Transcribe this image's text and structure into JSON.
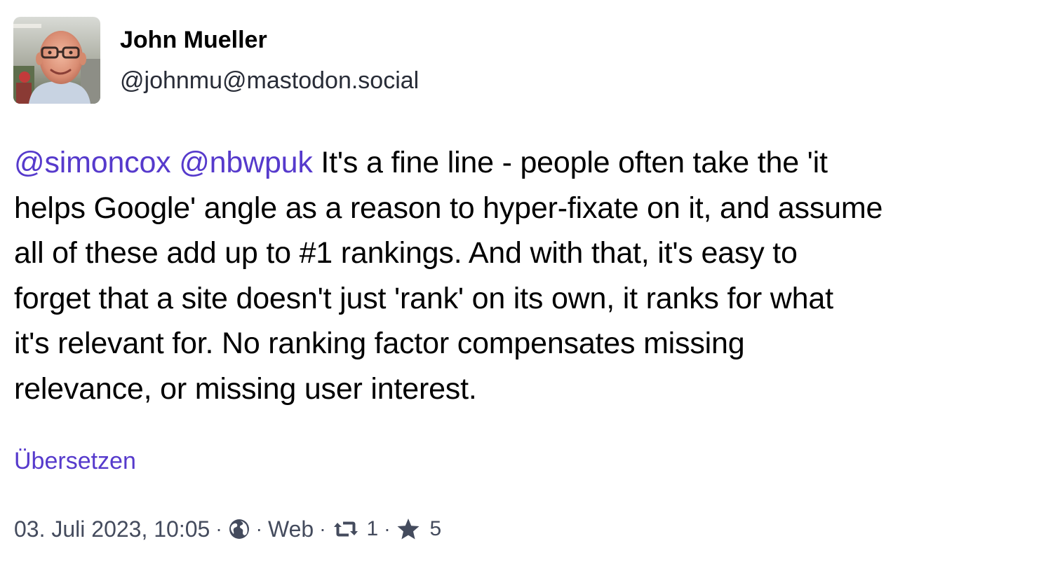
{
  "author": {
    "display_name": "John Mueller",
    "account": "@johnmu@mastodon.social",
    "avatar": "profile-photo"
  },
  "status": {
    "mentions": [
      "@simoncox",
      "@nbwpuk"
    ],
    "lines": [
      " It's a fine line - people often take the 'it",
      "helps Google' angle as a reason to hyper-fixate on it, and assume",
      "all of these add up to #1 rankings. And with that, it's easy to",
      "forget that a site doesn't just 'rank' on its own, it ranks for what",
      "it's relevant for. No ranking factor compensates missing",
      "relevance, or missing user interest."
    ],
    "translate_label": "Übersetzen"
  },
  "meta": {
    "date": "03. Juli 2023, 10:05",
    "separator": "·",
    "visibility_icon": "globe-icon",
    "application": "Web",
    "reblog_icon": "retweet-icon",
    "reblogs": "1",
    "favourite_icon": "star-icon",
    "favourites": "5"
  },
  "colors": {
    "link": "#563acc",
    "meta_text": "#444b5d",
    "icon": "#444b5d"
  }
}
